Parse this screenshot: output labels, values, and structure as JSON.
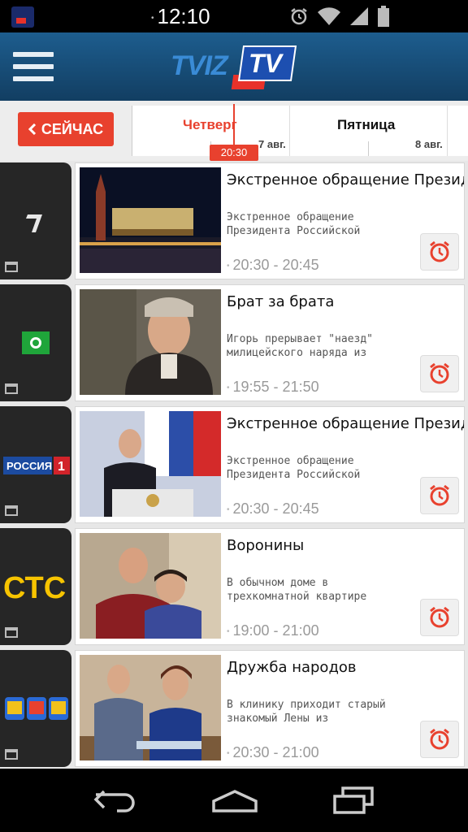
{
  "status_bar": {
    "time": "12:10",
    "icons": [
      "tviz-app-icon",
      "alarm-icon",
      "wifi-icon",
      "signal-icon",
      "battery-icon"
    ]
  },
  "app_bar": {
    "logo_text_1": "TVIZ",
    "logo_text_2": "TV"
  },
  "day_bar": {
    "now_button": "СЕЙЧАС",
    "days": [
      {
        "name": "Четверг",
        "date": "7 авг.",
        "active": true
      },
      {
        "name": "Пятница",
        "date": "8 авг.",
        "active": false
      }
    ],
    "current_time": "20:30"
  },
  "programs": [
    {
      "channel": "Первый канал",
      "title": "Экстренное обращение Президента",
      "description": "Экстренное обращение Президента Российской",
      "time": "20:30 - 20:45"
    },
    {
      "channel": "НТВ",
      "title": "Брат за брата",
      "description": "Игорь прерывает \"наезд\" милицейского наряда из",
      "time": "19:55 - 21:50"
    },
    {
      "channel": "РОССИЯ 1",
      "title": "Экстренное обращение Президента",
      "description": "Экстренное обращение Президента Российской",
      "time": "20:30 - 20:45"
    },
    {
      "channel": "СТС",
      "title": "Воронины",
      "description": "В обычном доме в трехкомнатной квартире",
      "time": "19:00 - 21:00"
    },
    {
      "channel": "Домашний",
      "title": "Дружба народов",
      "description": "В клинику приходит старый знакомый Лены из",
      "time": "20:30 - 21:00"
    }
  ],
  "colors": {
    "accent": "#e8412e",
    "appbar": "#1d5d8e"
  }
}
